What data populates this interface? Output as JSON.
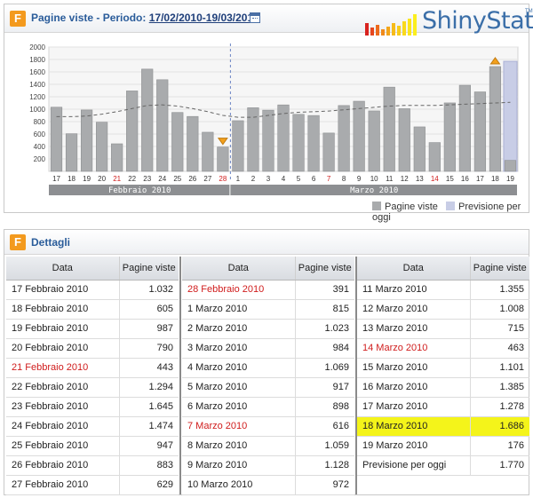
{
  "header": {
    "title_prefix": "Pagine viste - Periodo:",
    "period": "17/02/2010-19/03/2010",
    "brand": "ShinyStat",
    "brand_tm": "TM"
  },
  "colors": {
    "bar": "#a9abad",
    "forecast": "#c8cde6",
    "avg_line": "#666666",
    "weekend_label": "#d01c1c",
    "highlight": "#f4f41a",
    "accent": "#2a5c9a"
  },
  "chart_data": {
    "type": "bar",
    "categories": [
      "17",
      "18",
      "19",
      "20",
      "21",
      "22",
      "23",
      "24",
      "25",
      "26",
      "27",
      "28",
      "1",
      "2",
      "3",
      "4",
      "5",
      "6",
      "7",
      "8",
      "9",
      "10",
      "11",
      "12",
      "13",
      "14",
      "15",
      "16",
      "17",
      "18",
      "19"
    ],
    "red_categories": [
      4,
      11,
      18,
      25
    ],
    "groups": [
      {
        "label": "Febbraio 2010",
        "from": 0,
        "to": 11
      },
      {
        "label": "Marzo 2010",
        "from": 12,
        "to": 30
      }
    ],
    "series": [
      {
        "name": "Pagine viste",
        "values": [
          1032,
          605,
          987,
          790,
          443,
          1294,
          1645,
          1474,
          947,
          883,
          629,
          391,
          815,
          1023,
          984,
          1069,
          917,
          898,
          616,
          1059,
          1128,
          972,
          1355,
          1008,
          715,
          463,
          1101,
          1385,
          1278,
          1686,
          176
        ]
      },
      {
        "name": "Previsione per oggi",
        "values": [
          null,
          null,
          null,
          null,
          null,
          null,
          null,
          null,
          null,
          null,
          null,
          null,
          null,
          null,
          null,
          null,
          null,
          null,
          null,
          null,
          null,
          null,
          null,
          null,
          null,
          null,
          null,
          null,
          null,
          null,
          1770
        ]
      }
    ],
    "moving_average": [
      880,
      880,
      890,
      920,
      960,
      1010,
      1060,
      1070,
      1050,
      1010,
      960,
      900,
      870,
      870,
      900,
      930,
      950,
      960,
      970,
      990,
      1010,
      1030,
      1050,
      1060,
      1060,
      1060,
      1070,
      1080,
      1090,
      1100,
      1110
    ],
    "ylim": [
      0,
      2000
    ],
    "yticks": [
      200,
      400,
      600,
      800,
      1000,
      1200,
      1400,
      1600,
      1800,
      2000
    ],
    "markers": [
      {
        "index": 11,
        "type": "min"
      },
      {
        "index": 29,
        "type": "max"
      }
    ],
    "legend": [
      "Pagine viste",
      "Previsione per oggi"
    ],
    "legend_position": "bottom-right"
  },
  "details": {
    "title": "Dettagli",
    "col_date": "Data",
    "col_views": "Pagine viste",
    "columns": [
      [
        {
          "date": "17 Febbraio 2010",
          "views": "1.032",
          "red": false,
          "hl": false
        },
        {
          "date": "18 Febbraio 2010",
          "views": "605",
          "red": false,
          "hl": false
        },
        {
          "date": "19 Febbraio 2010",
          "views": "987",
          "red": false,
          "hl": false
        },
        {
          "date": "20 Febbraio 2010",
          "views": "790",
          "red": false,
          "hl": false
        },
        {
          "date": "21 Febbraio 2010",
          "views": "443",
          "red": true,
          "hl": false
        },
        {
          "date": "22 Febbraio 2010",
          "views": "1.294",
          "red": false,
          "hl": false
        },
        {
          "date": "23 Febbraio 2010",
          "views": "1.645",
          "red": false,
          "hl": false
        },
        {
          "date": "24 Febbraio 2010",
          "views": "1.474",
          "red": false,
          "hl": false
        },
        {
          "date": "25 Febbraio 2010",
          "views": "947",
          "red": false,
          "hl": false
        },
        {
          "date": "26 Febbraio 2010",
          "views": "883",
          "red": false,
          "hl": false
        },
        {
          "date": "27 Febbraio 2010",
          "views": "629",
          "red": false,
          "hl": false
        }
      ],
      [
        {
          "date": "28 Febbraio 2010",
          "views": "391",
          "red": true,
          "hl": false
        },
        {
          "date": "1 Marzo 2010",
          "views": "815",
          "red": false,
          "hl": false
        },
        {
          "date": "2 Marzo 2010",
          "views": "1.023",
          "red": false,
          "hl": false
        },
        {
          "date": "3 Marzo 2010",
          "views": "984",
          "red": false,
          "hl": false
        },
        {
          "date": "4 Marzo 2010",
          "views": "1.069",
          "red": false,
          "hl": false
        },
        {
          "date": "5 Marzo 2010",
          "views": "917",
          "red": false,
          "hl": false
        },
        {
          "date": "6 Marzo 2010",
          "views": "898",
          "red": false,
          "hl": false
        },
        {
          "date": "7 Marzo 2010",
          "views": "616",
          "red": true,
          "hl": false
        },
        {
          "date": "8 Marzo 2010",
          "views": "1.059",
          "red": false,
          "hl": false
        },
        {
          "date": "9 Marzo 2010",
          "views": "1.128",
          "red": false,
          "hl": false
        },
        {
          "date": "10 Marzo 2010",
          "views": "972",
          "red": false,
          "hl": false
        }
      ],
      [
        {
          "date": "11 Marzo 2010",
          "views": "1.355",
          "red": false,
          "hl": false
        },
        {
          "date": "12 Marzo 2010",
          "views": "1.008",
          "red": false,
          "hl": false
        },
        {
          "date": "13 Marzo 2010",
          "views": "715",
          "red": false,
          "hl": false
        },
        {
          "date": "14 Marzo 2010",
          "views": "463",
          "red": true,
          "hl": false
        },
        {
          "date": "15 Marzo 2010",
          "views": "1.101",
          "red": false,
          "hl": false
        },
        {
          "date": "16 Marzo 2010",
          "views": "1.385",
          "red": false,
          "hl": false
        },
        {
          "date": "17 Marzo 2010",
          "views": "1.278",
          "red": false,
          "hl": false
        },
        {
          "date": "18 Marzo 2010",
          "views": "1.686",
          "red": false,
          "hl": true
        },
        {
          "date": "19 Marzo 2010",
          "views": "176",
          "red": false,
          "hl": false
        },
        {
          "date": "Previsione per oggi",
          "views": "1.770",
          "red": false,
          "hl": false
        }
      ]
    ]
  }
}
